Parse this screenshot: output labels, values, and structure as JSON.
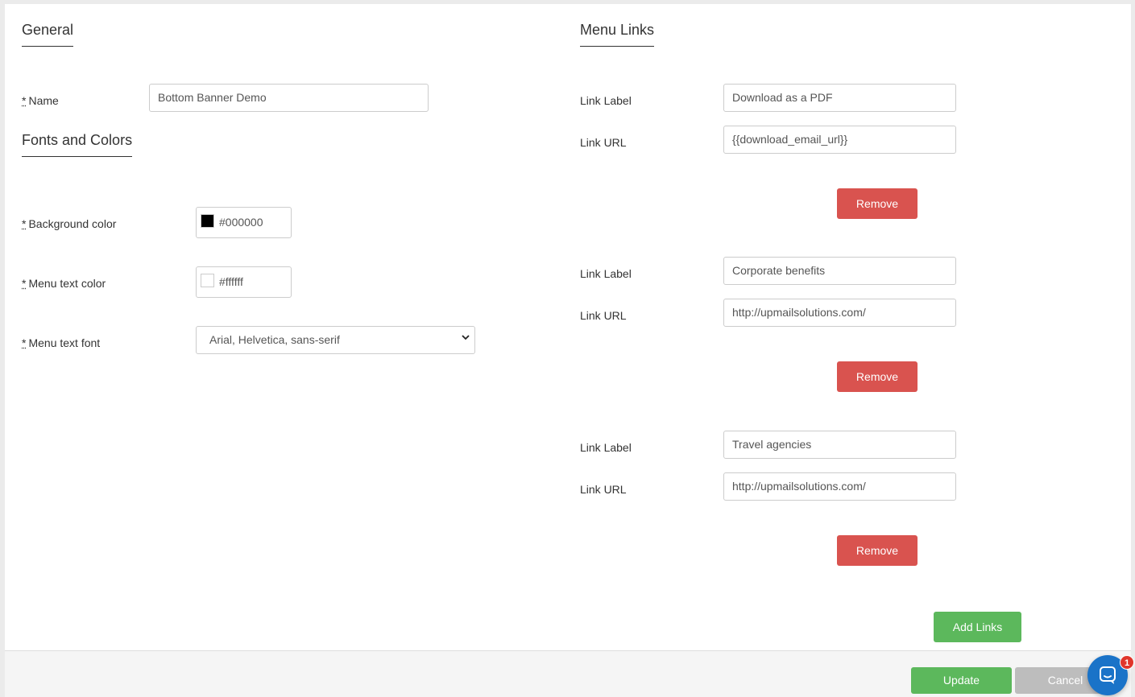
{
  "general": {
    "title": "General",
    "name_label": "Name",
    "name_value": "Bottom Banner Demo"
  },
  "fonts_colors": {
    "title": "Fonts and Colors",
    "background_color_label": "Background color",
    "background_color_value": "#000000",
    "background_swatch": "#000000",
    "menu_text_color_label": "Menu text color",
    "menu_text_color_value": "#ffffff",
    "menu_text_swatch": "#ffffff",
    "menu_text_font_label": "Menu text font",
    "menu_text_font_value": "Arial, Helvetica, sans-serif"
  },
  "required_marker": "*",
  "menu_links": {
    "title": "Menu Links",
    "label_caption": "Link Label",
    "url_caption": "Link URL",
    "remove_label": "Remove",
    "items": [
      {
        "label": "Download as a PDF",
        "url": "{{download_email_url}}"
      },
      {
        "label": "Corporate benefits",
        "url": "http://upmailsolutions.com/"
      },
      {
        "label": "Travel agencies",
        "url": "http://upmailsolutions.com/"
      }
    ],
    "add_label": "Add Links"
  },
  "footer": {
    "update_label": "Update",
    "cancel_label": "Cancel"
  },
  "chat": {
    "badge_count": "1"
  },
  "colors": {
    "danger": "#d9534f",
    "success": "#5cb85c",
    "chat": "#1a73c8"
  }
}
